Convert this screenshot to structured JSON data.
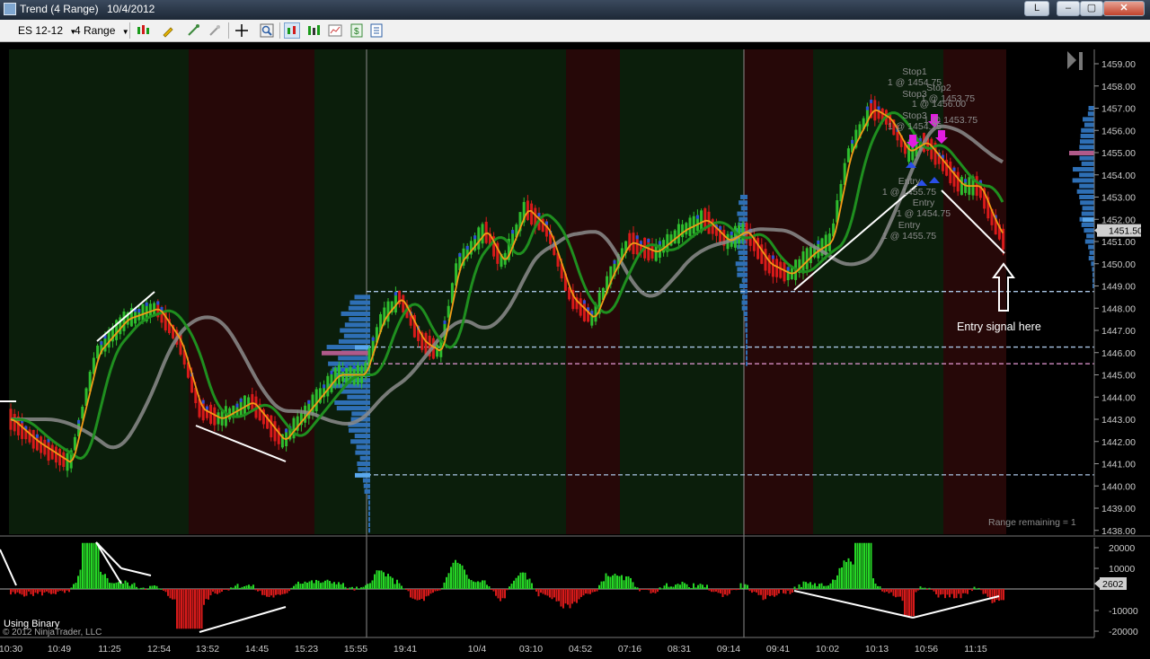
{
  "window": {
    "title_parts": [
      "Trend (4 Range)",
      "10/4/2012"
    ],
    "buttons": {
      "layout": "L",
      "minimize": "–",
      "maximize": "▢",
      "close": "✕"
    }
  },
  "toolbar": {
    "instrument": "ES 12-12",
    "period": "4 Range",
    "icons": [
      "candlestick-icon",
      "pencil-icon",
      "drawing-tool-icon",
      "magnet-icon",
      "crosshair-icon",
      "zoom-icon",
      "bar-style-icon",
      "chart-style-icon",
      "data-box-icon",
      "dollar-icon",
      "properties-icon"
    ]
  },
  "chart": {
    "price_axis": {
      "min": 1438.0,
      "max": 1459.0,
      "step": 1.0,
      "labels": [
        "1459.00",
        "1458.00",
        "1457.00",
        "1456.00",
        "1455.00",
        "1454.00",
        "1453.00",
        "1452.00",
        "1451.00",
        "1450.00",
        "1449.00",
        "1448.00",
        "1447.00",
        "1446.00",
        "1445.00",
        "1444.00",
        "1443.00",
        "1442.00",
        "1441.00",
        "1440.00",
        "1439.00",
        "1438.00"
      ]
    },
    "last_price": "1451.50",
    "indicator_last": "2602",
    "indicator_axis_labels": [
      "20000",
      "10000",
      "-10000",
      "-20000"
    ],
    "time_labels": [
      "10:30",
      "10:49",
      "11:25",
      "12:54",
      "13:52",
      "14:45",
      "15:23",
      "15:55",
      "19:41",
      "10/4",
      "03:10",
      "04:52",
      "07:16",
      "08:31",
      "09:14",
      "09:41",
      "10:02",
      "10:13",
      "10:56",
      "11:15"
    ],
    "range_remaining": "Range remaining = 1",
    "annotation": "Entry signal here",
    "order_labels": {
      "stop1": [
        "Stop1",
        "1 @ 1454.75"
      ],
      "stop_overlap": [
        "Stop2",
        "1 @ 1453.75",
        "Stop3",
        "1 @ 1456.00",
        "1 @ 1453.75",
        "Stop3",
        "1 @ 1454.75"
      ],
      "entries": [
        "Entry",
        "1 @ 1455.75",
        "Entry",
        "1 @ 1454.75",
        "Entry",
        "1 @ 1455.75"
      ]
    },
    "panel_label": "Using Binary",
    "copyright": "© 2012 NinjaTrader, LLC",
    "colors": {
      "up_bar": "#2ebd2e",
      "down_bar": "#d91a1a",
      "fast_ma": "#f39a16",
      "mid_ma": "#1f8f1f",
      "slow_ma": "#8c8c8c",
      "volume_profile": "#2e6fb5"
    }
  }
}
